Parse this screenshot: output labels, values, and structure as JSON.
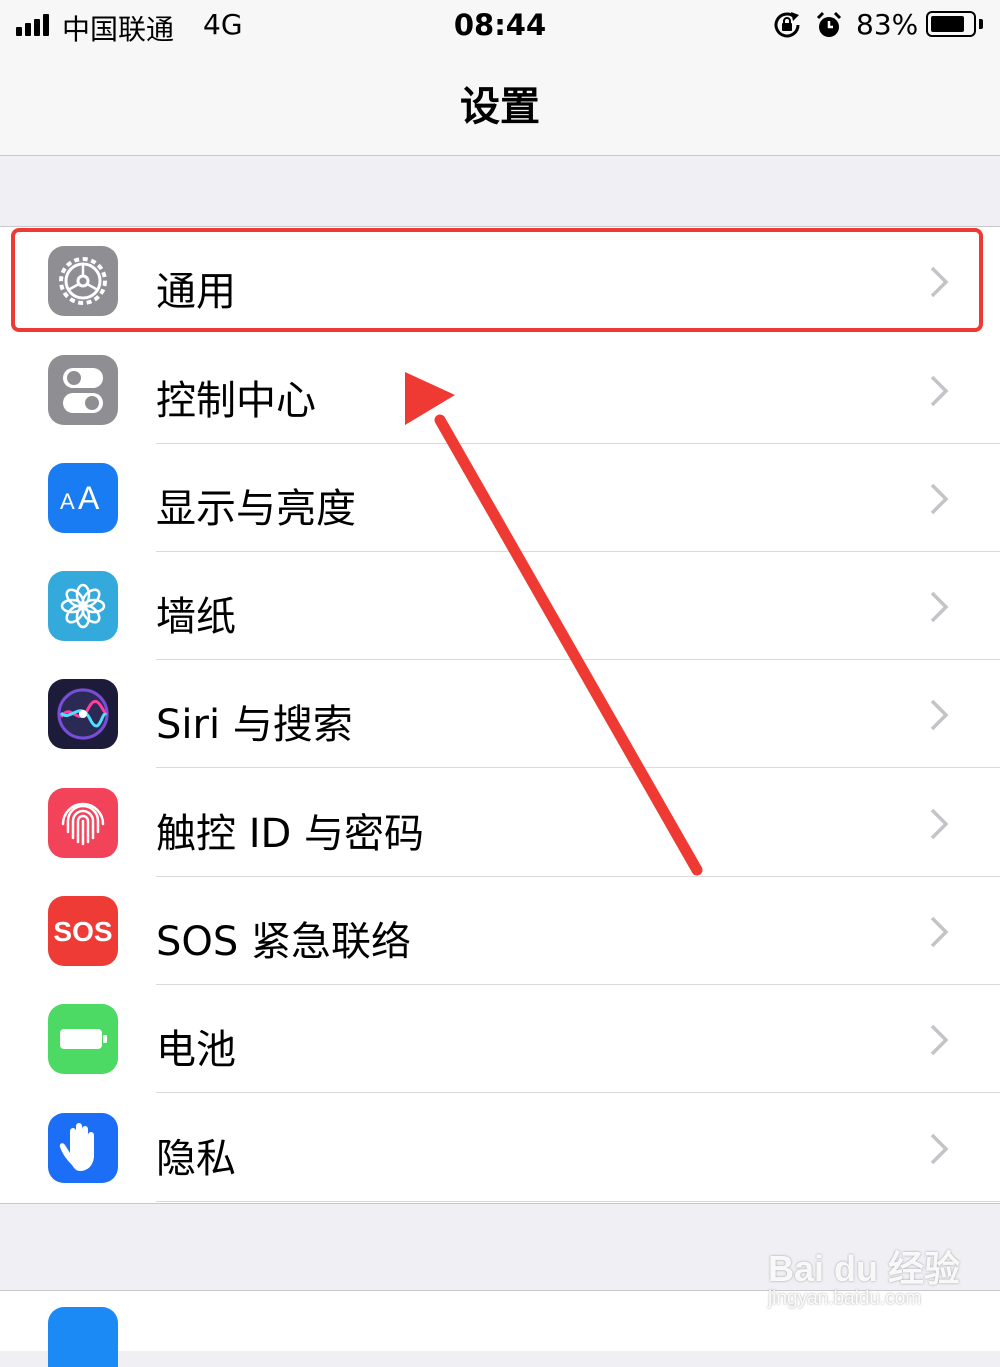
{
  "status_bar": {
    "carrier": "中国联通",
    "network": "4G",
    "time": "08:44",
    "battery_percent": "83%",
    "battery_level": 0.83,
    "icons": [
      "signal-icon",
      "rotation-lock-icon",
      "alarm-icon",
      "battery-icon"
    ]
  },
  "nav": {
    "title": "设置"
  },
  "settings": {
    "items": [
      {
        "label": "通用",
        "icon": "gear-icon",
        "color": "#8e8e93"
      },
      {
        "label": "控制中心",
        "icon": "toggle-switches-icon",
        "color": "#8e8e93"
      },
      {
        "label": "显示与亮度",
        "icon": "text-size-icon",
        "color": "#1a7cf2"
      },
      {
        "label": "墙纸",
        "icon": "flower-icon",
        "color": "#34aadc"
      },
      {
        "label": "Siri 与搜索",
        "icon": "siri-icon",
        "color": "#1c1c3a"
      },
      {
        "label": "触控 ID 与密码",
        "icon": "fingerprint-icon",
        "color": "#f2435a"
      },
      {
        "label": "SOS 紧急联络",
        "icon": "sos-icon",
        "color": "#ee3b36",
        "icon_text": "SOS"
      },
      {
        "label": "电池",
        "icon": "battery-icon",
        "color": "#4cd964"
      },
      {
        "label": "隐私",
        "icon": "hand-icon",
        "color": "#1b6ef5"
      }
    ],
    "icon_glyphs": {
      "aa_small": "A",
      "aa_large": "A"
    }
  },
  "annotation": {
    "highlight_color": "#ee3a33"
  },
  "watermark": {
    "logo": "Bai du 经验",
    "url": "jingyan.baidu.com"
  }
}
